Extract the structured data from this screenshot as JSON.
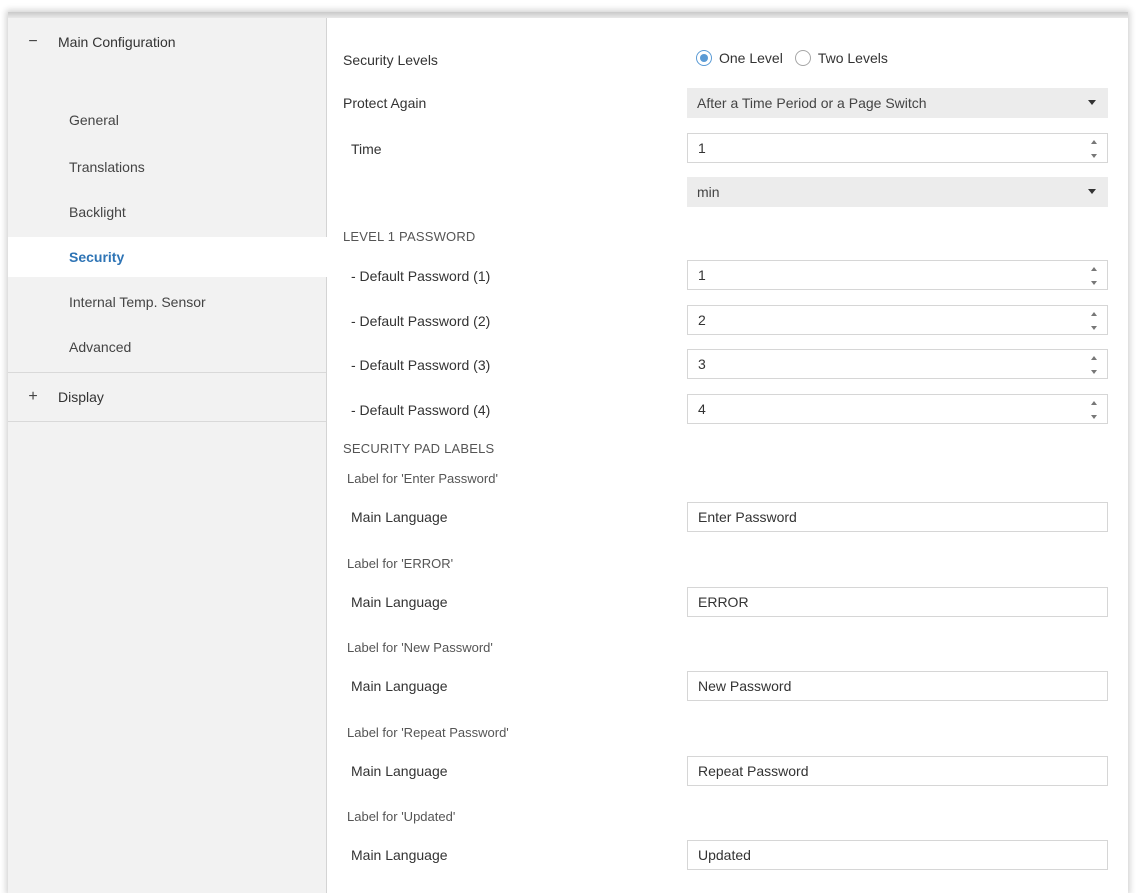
{
  "sidebar": {
    "main_group": {
      "sign": "−",
      "label": "Main Configuration"
    },
    "items": [
      {
        "label": "General"
      },
      {
        "label": "Translations"
      },
      {
        "label": "Backlight"
      },
      {
        "label": "Security"
      },
      {
        "label": "Internal Temp. Sensor"
      },
      {
        "label": "Advanced"
      }
    ],
    "display_group": {
      "sign": "+",
      "label": "Display"
    }
  },
  "security": {
    "security_levels": {
      "label": "Security Levels",
      "options": [
        "One Level",
        "Two Levels"
      ],
      "selected": "One Level"
    },
    "protect_again": {
      "label": "Protect Again",
      "value": "After a Time Period or a Page Switch"
    },
    "time": {
      "label": "Time",
      "value": "1",
      "unit": "min"
    },
    "level1_section": "LEVEL 1 PASSWORD",
    "passwords": [
      {
        "label": "- Default Password (1)",
        "value": "1"
      },
      {
        "label": "- Default Password (2)",
        "value": "2"
      },
      {
        "label": "- Default Password (3)",
        "value": "3"
      },
      {
        "label": "- Default Password (4)",
        "value": "4"
      }
    ],
    "pad_section": "SECURITY PAD LABELS",
    "pad_labels": [
      {
        "group": "Label for 'Enter Password'",
        "lang_label": "Main Language",
        "value": "Enter Password"
      },
      {
        "group": "Label for 'ERROR'",
        "lang_label": "Main Language",
        "value": "ERROR"
      },
      {
        "group": "Label for 'New Password'",
        "lang_label": "Main Language",
        "value": "New Password"
      },
      {
        "group": "Label for 'Repeat Password'",
        "lang_label": "Main Language",
        "value": "Repeat Password"
      },
      {
        "group": "Label for 'Updated'",
        "lang_label": "Main Language",
        "value": "Updated"
      }
    ]
  },
  "colors": {
    "accent": "#2e74b5",
    "radio": "#5b9bd5",
    "sidebar_bg": "#f2f2f2"
  }
}
